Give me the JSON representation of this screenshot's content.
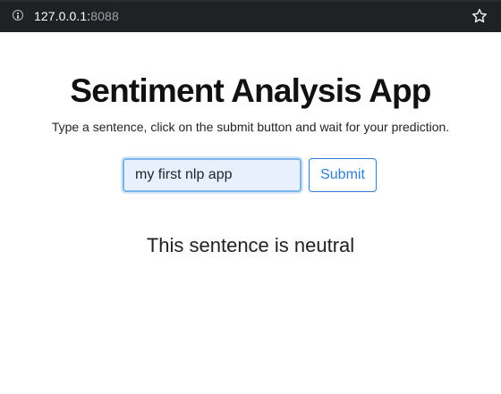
{
  "browser": {
    "url_host": "127.0.0.1:",
    "url_port": "8088",
    "info_icon": "info-icon",
    "bookmark_icon": "star-icon"
  },
  "page": {
    "title": "Sentiment Analysis App",
    "subtitle": "Type a sentence, click on the submit button and wait for your prediction.",
    "input_value": "my first nlp app",
    "submit_label": "Submit",
    "result": "This sentence is neutral"
  },
  "colors": {
    "browser_bar": "#202124",
    "input_focus_border": "#7ab4e8",
    "input_autofill_bg": "#e8f0fe",
    "button_accent": "#2f7fd1"
  }
}
